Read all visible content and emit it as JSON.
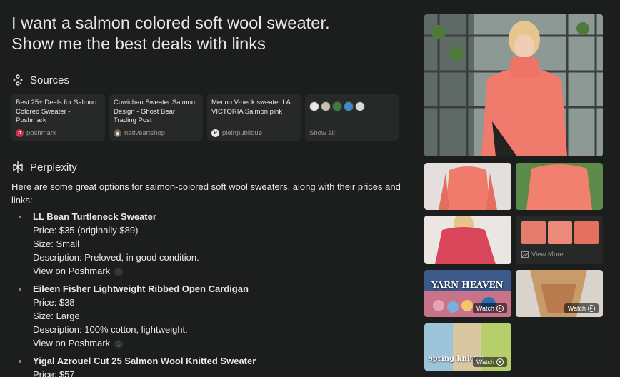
{
  "query": {
    "line1": "I want a salmon colored soft wool sweater.",
    "line2": "Show me the best deals with links"
  },
  "sources": {
    "heading": "Sources",
    "cards": [
      {
        "title": "Best 25+ Deals for Salmon Colored Sweater - Poshmark",
        "site": "poshmark",
        "icon_color": "#c8304f"
      },
      {
        "title": "Cowichan Sweater Salmon Design - Ghost Bear Trading Post",
        "site": "nativeartshop",
        "icon_color": "#6b5a4a"
      },
      {
        "title": "Merino V-neck sweater LA VICTORIA Salmon pink",
        "site": "pleinpublique",
        "icon_color": "#e8e8e6"
      }
    ],
    "show_all": "Show all",
    "show_all_icons": [
      "#e8e8e6",
      "#c9c2b0",
      "#3f7c3a",
      "#3a8fc9",
      "#d8d8d8"
    ]
  },
  "answer": {
    "heading": "Perplexity",
    "intro": "Here are some great options for salmon-colored soft wool sweaters, along with their prices and links:",
    "items": [
      {
        "name": "LL Bean Turtleneck Sweater",
        "price": "Price: $35 (originally $89)",
        "size": "Size: Small",
        "desc": "Description: Preloved, in good condition.",
        "link": "View on Poshmark",
        "cite": "1"
      },
      {
        "name": "Eileen Fisher Lightweight Ribbed Open Cardigan",
        "price": "Price: $38",
        "size": "Size: Large",
        "desc": "Description: 100% cotton, lightweight.",
        "link": "View on Poshmark",
        "cite": "1"
      },
      {
        "name": "Yigal Azrouel Cut 25 Salmon Wool Knitted Sweater",
        "price": "Price: $57"
      }
    ]
  },
  "media": {
    "view_more": "View More",
    "watch_label": "Watch",
    "video1_text": "YARN HEAVEN",
    "video3_text": "spring knittin"
  }
}
